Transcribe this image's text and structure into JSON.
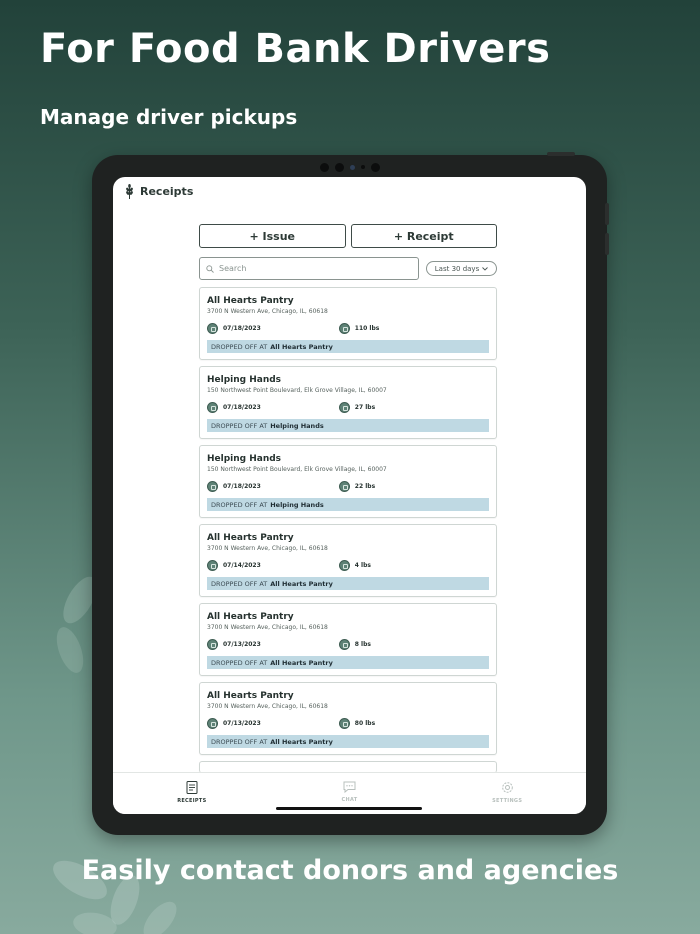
{
  "promo": {
    "headline": "For Food Bank Drivers",
    "subhead": "Manage driver pickups",
    "footer": "Easily contact donors and agencies"
  },
  "header": {
    "title": "Receipts",
    "logo_icon": "wheat-icon"
  },
  "actions": {
    "issue_label": "+ Issue",
    "receipt_label": "+ Receipt"
  },
  "search": {
    "placeholder": "Search",
    "range": "Last 30 days"
  },
  "receipts": [
    {
      "name": "All Hearts Pantry",
      "address": "3700 N Western Ave, Chicago, IL, 60618",
      "date": "07/18/2023",
      "weight": "110 lbs",
      "drop_prefix": "DROPPED OFF AT",
      "drop_place": "All Hearts Pantry"
    },
    {
      "name": "Helping Hands",
      "address": "150 Northwest Point Boulevard, Elk Grove Village, IL, 60007",
      "date": "07/18/2023",
      "weight": "27 lbs",
      "drop_prefix": "DROPPED OFF AT",
      "drop_place": "Helping Hands"
    },
    {
      "name": "Helping Hands",
      "address": "150 Northwest Point Boulevard, Elk Grove Village, IL, 60007",
      "date": "07/18/2023",
      "weight": "22 lbs",
      "drop_prefix": "DROPPED OFF AT",
      "drop_place": "Helping Hands"
    },
    {
      "name": "All Hearts Pantry",
      "address": "3700 N Western Ave, Chicago, IL, 60618",
      "date": "07/14/2023",
      "weight": "4 lbs",
      "drop_prefix": "DROPPED OFF AT",
      "drop_place": "All Hearts Pantry"
    },
    {
      "name": "All Hearts Pantry",
      "address": "3700 N Western Ave, Chicago, IL, 60618",
      "date": "07/13/2023",
      "weight": "8 lbs",
      "drop_prefix": "DROPPED OFF AT",
      "drop_place": "All Hearts Pantry"
    },
    {
      "name": "All Hearts Pantry",
      "address": "3700 N Western Ave, Chicago, IL, 60618",
      "date": "07/13/2023",
      "weight": "80 lbs",
      "drop_prefix": "DROPPED OFF AT",
      "drop_place": "All Hearts Pantry"
    }
  ],
  "tabs": [
    {
      "label": "RECEIPTS",
      "icon": "receipt-icon",
      "active": true
    },
    {
      "label": "CHAT",
      "icon": "chat-icon",
      "active": false
    },
    {
      "label": "SETTINGS",
      "icon": "gear-icon",
      "active": false
    }
  ],
  "colors": {
    "accent": "#2d3a36",
    "drop_bar": "#bfd9e3",
    "background_top": "#22423a",
    "background_bottom": "#88aa9e"
  }
}
